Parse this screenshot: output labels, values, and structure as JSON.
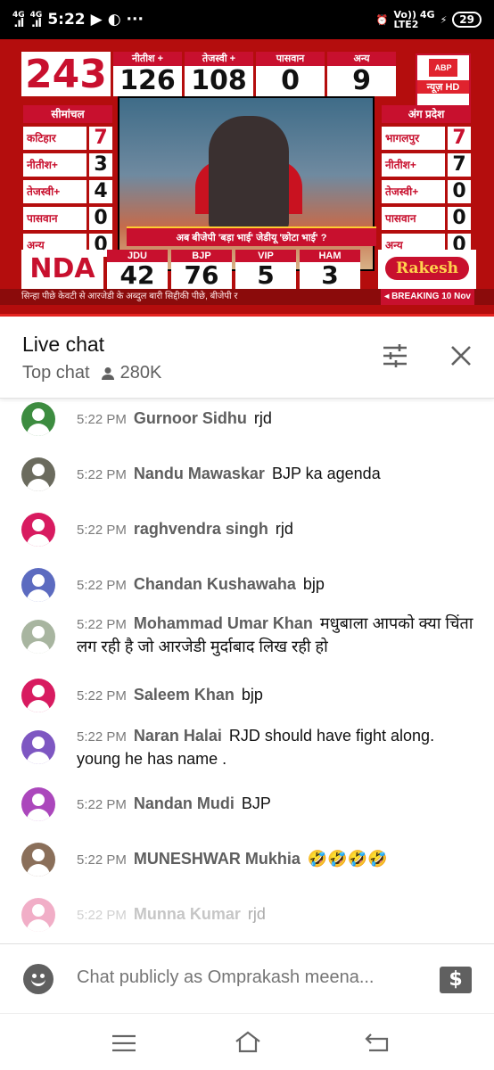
{
  "status_bar": {
    "network1": "4G",
    "network2": "4G",
    "time": "5:22",
    "volte": "Vo)) 4G",
    "lte": "LTE2",
    "battery": "29"
  },
  "video": {
    "total_seats": "243",
    "parties": [
      {
        "name": "नीतीश +",
        "value": "126"
      },
      {
        "name": "तेजस्वी +",
        "value": "108"
      },
      {
        "name": "पासवान",
        "value": "0"
      },
      {
        "name": "अन्य",
        "value": "9"
      }
    ],
    "channel_logo": {
      "top": "ABP",
      "bottom": "न्यूज़ HD"
    },
    "left_panel": {
      "header": "सीमांचल",
      "rows": [
        {
          "label": "कटिहार",
          "value": "7"
        },
        {
          "label": "नीतीश+",
          "value": "3"
        },
        {
          "label": "तेजस्वी+",
          "value": "4"
        },
        {
          "label": "पासवान",
          "value": "0"
        },
        {
          "label": "अन्य",
          "value": "0"
        }
      ]
    },
    "right_panel": {
      "header": "अंग प्रदेश",
      "rows": [
        {
          "label": "भागलपुर",
          "value": "7"
        },
        {
          "label": "नीतीश+",
          "value": "7"
        },
        {
          "label": "तेजस्वी+",
          "value": "0"
        },
        {
          "label": "पासवान",
          "value": "0"
        },
        {
          "label": "अन्य",
          "value": "0"
        }
      ]
    },
    "caption": "अब बीजेपी 'बड़ा भाई' जेडीयू 'छोटा भाई' ?",
    "alliance_label": "NDA",
    "allies": [
      {
        "name": "JDU",
        "value": "42"
      },
      {
        "name": "BJP",
        "value": "76"
      },
      {
        "name": "VIP",
        "value": "5"
      },
      {
        "name": "HAM",
        "value": "3"
      }
    ],
    "sponsor": "Rakesh",
    "ticker": "सिन्हा पीछे     केवटी से आरजेडी के अब्दुल बारी सिद्दीकी पीछे, बीजेपी र",
    "breaking": "◂ BREAKING  10 Nov",
    "progress_fraction": 1.0
  },
  "chat_header": {
    "title": "Live chat",
    "mode": "Top chat",
    "viewers": "280K"
  },
  "messages": [
    {
      "time": "5:22 PM",
      "author": "Gurnoor Sidhu",
      "text": "rjd",
      "avatar_color": "#3d8c40"
    },
    {
      "time": "5:22 PM",
      "author": "Nandu Mawaskar",
      "text": "BJP ka agenda",
      "avatar_color": "#6b6b5e"
    },
    {
      "time": "5:22 PM",
      "author": "raghvendra singh",
      "text": "rjd",
      "avatar_color": "#d81b60"
    },
    {
      "time": "5:22 PM",
      "author": "Chandan Kushawaha",
      "text": "bjp",
      "avatar_color": "#5c6bc0"
    },
    {
      "time": "5:22 PM",
      "author": "Mohammad Umar Khan",
      "text": "मधुबाला आपको क्या चिंता लग रही है जो आरजेडी मुर्दाबाद लिख रही हो",
      "avatar_color": "#a8b5a0"
    },
    {
      "time": "5:22 PM",
      "author": "Saleem Khan",
      "text": "bjp",
      "avatar_color": "#d81b60"
    },
    {
      "time": "5:22 PM",
      "author": "Naran Halai",
      "text": "RJD should have fight along. young he has name .",
      "avatar_color": "#7e57c2"
    },
    {
      "time": "5:22 PM",
      "author": "Nandan Mudi",
      "text": "BJP",
      "avatar_color": "#ab47bc"
    },
    {
      "time": "5:22 PM",
      "author": "MUNESHWAR Mukhia",
      "text": "🤣🤣🤣🤣",
      "avatar_color": "#8a6f5a"
    },
    {
      "time": "5:22 PM",
      "author": "Munna Kumar",
      "text": "rjd",
      "avatar_color": "#d81b60"
    }
  ],
  "input": {
    "placeholder": "Chat publicly as Omprakash meena...",
    "superchat_icon": "dollar-icon"
  },
  "nav": {
    "icons": [
      "menu-icon",
      "home-icon",
      "back-icon"
    ]
  },
  "colors": {
    "accent_red": "#c8102e",
    "progress_red": "#e52421"
  }
}
